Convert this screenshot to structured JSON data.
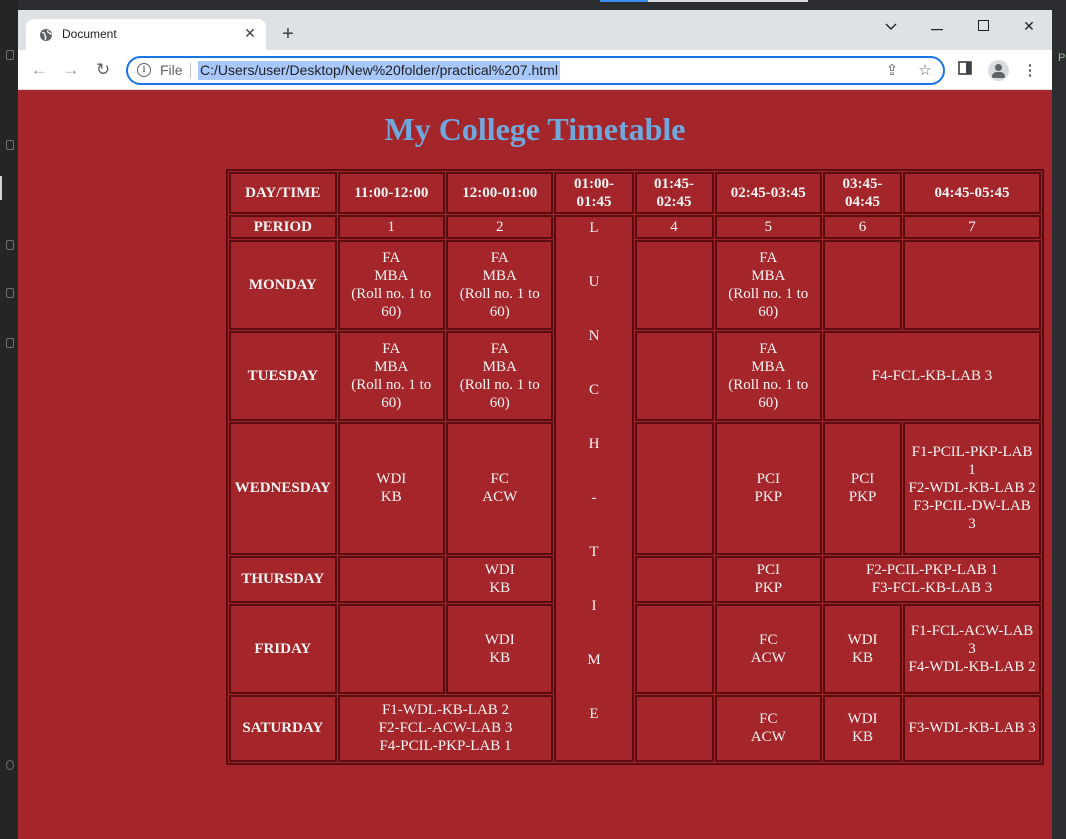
{
  "browser": {
    "tab_title": "Document",
    "omnibox_scheme": "File",
    "url": "C:/Users/user/Desktop/New%20folder/practical%207.html"
  },
  "page": {
    "title": "My College Timetable"
  },
  "timetable": {
    "headers": [
      "DAY/TIME",
      "11:00-12:00",
      "12:00-01:00",
      "01:00-01:45",
      "01:45-02:45",
      "02:45-03:45",
      "03:45-04:45",
      "04:45-05:45"
    ],
    "period_label": "PERIOD",
    "periods": [
      "1",
      "2",
      "4",
      "5",
      "6",
      "7"
    ],
    "lunch_letters": [
      "L",
      "U",
      "N",
      "C",
      "H",
      "-",
      "T",
      "I",
      "M",
      "E"
    ],
    "days": {
      "monday": "MONDAY",
      "tuesday": "TUESDAY",
      "wednesday": "WEDNESDAY",
      "thursday": "THURSDAY",
      "friday": "FRIDAY",
      "saturday": "SATURDAY"
    },
    "cells": {
      "fa_mba": [
        "FA",
        "MBA",
        "(Roll no. 1 to 60)"
      ],
      "tue_lab": "F4-FCL-KB-LAB 3",
      "wdi_kb": [
        "WDI",
        "KB"
      ],
      "fc_acw": [
        "FC",
        "ACW"
      ],
      "pci_pkp": [
        "PCI",
        "PKP"
      ],
      "wed_lab": [
        "F1-PCIL-PKP-LAB 1",
        "F2-WDL-KB-LAB 2",
        "F3-PCIL-DW-LAB 3"
      ],
      "thu_lab": [
        "F2-PCIL-PKP-LAB 1",
        "F3-FCL-KB-LAB 3"
      ],
      "fri_lab": [
        "F1-FCL-ACW-LAB 3",
        "F4-WDL-KB-LAB 2"
      ],
      "sat_lab": [
        "F1-WDL-KB-LAB 2",
        "F2-FCL-ACW-LAB 3",
        "F4-PCIL-PKP-LAB 1"
      ],
      "sat_last": "F3-WDL-KB-LAB 3"
    }
  }
}
